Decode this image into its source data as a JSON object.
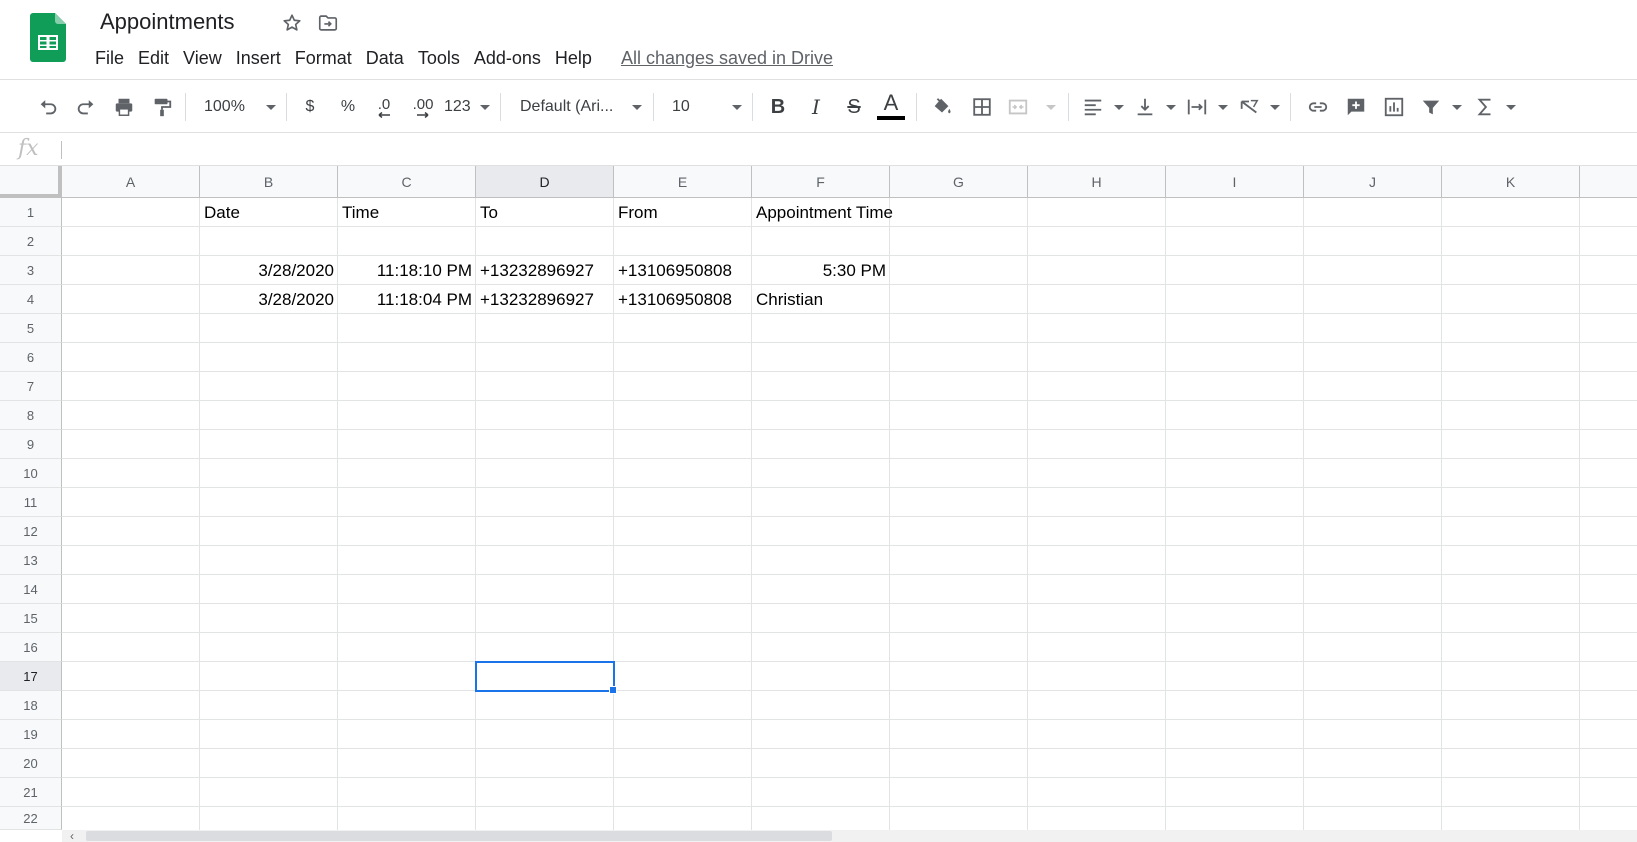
{
  "doc": {
    "title": "Appointments",
    "save_status": "All changes saved in Drive"
  },
  "menu": [
    "File",
    "Edit",
    "View",
    "Insert",
    "Format",
    "Data",
    "Tools",
    "Add-ons",
    "Help"
  ],
  "toolbar": {
    "zoom": "100%",
    "currency": "$",
    "percent": "%",
    "decrease_decimal": ".0",
    "increase_decimal": ".00",
    "more_formats": "123",
    "font": "Default (Ari...",
    "font_size": "10",
    "bold": "B",
    "italic": "I",
    "strikethrough": "S",
    "text_color": "A"
  },
  "formula_bar": {
    "label": "fx",
    "value": ""
  },
  "columns": [
    "A",
    "B",
    "C",
    "D",
    "E",
    "F",
    "G",
    "H",
    "I",
    "J",
    "K"
  ],
  "rows": [
    "1",
    "2",
    "3",
    "4",
    "5",
    "6",
    "7",
    "8",
    "9",
    "10",
    "11",
    "12",
    "13",
    "14",
    "15",
    "16",
    "17",
    "18",
    "19",
    "20",
    "21",
    "22"
  ],
  "cells": {
    "B1": "Date",
    "C1": "Time",
    "D1": "To",
    "E1": "From",
    "F1": "Appointment Time",
    "B3": "3/28/2020",
    "C3": "11:18:10 PM",
    "D3": "+13232896927",
    "E3": "+13106950808",
    "F3": "5:30 PM",
    "B4": "3/28/2020",
    "C4": "11:18:04 PM",
    "D4": "+13232896927",
    "E4": "+13106950808",
    "F4": "Christian"
  },
  "selection": {
    "cell": "D17"
  },
  "colors": {
    "accent": "#1a73e8",
    "sheets_green": "#0f9d58"
  }
}
